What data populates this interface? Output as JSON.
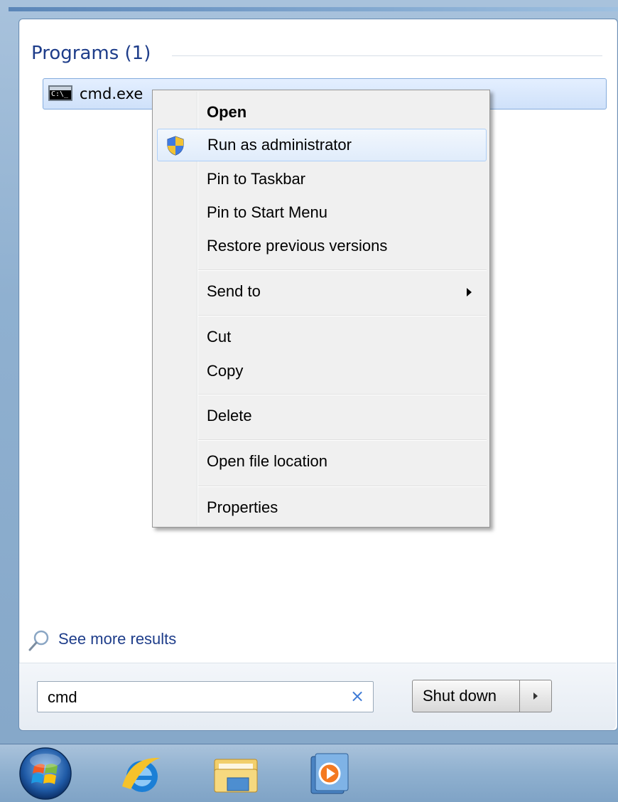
{
  "start_menu": {
    "section_title": "Programs (1)",
    "result_item": {
      "icon": "cmd-icon",
      "icon_text": "C:\\_",
      "label": "cmd.exe"
    },
    "see_more": {
      "icon": "search-icon",
      "label": "See more results"
    },
    "search": {
      "value": "cmd",
      "clear_icon": "×"
    },
    "shutdown": {
      "label": "Shut down"
    }
  },
  "context_menu": {
    "items": [
      {
        "label": "Open",
        "bold": true
      },
      {
        "label": "Run as administrator",
        "icon": "uac-shield-icon",
        "highlighted": true
      },
      {
        "label": "Pin to Taskbar"
      },
      {
        "label": "Pin to Start Menu"
      },
      {
        "label": "Restore previous versions"
      },
      {
        "label": "Send to",
        "submenu": true
      },
      {
        "label": "Cut"
      },
      {
        "label": "Copy"
      },
      {
        "label": "Delete"
      },
      {
        "label": "Open file location"
      },
      {
        "label": "Properties"
      }
    ]
  },
  "taskbar": {
    "icons": [
      "start-orb-icon",
      "internet-explorer-icon",
      "windows-explorer-icon",
      "media-player-icon"
    ]
  }
}
